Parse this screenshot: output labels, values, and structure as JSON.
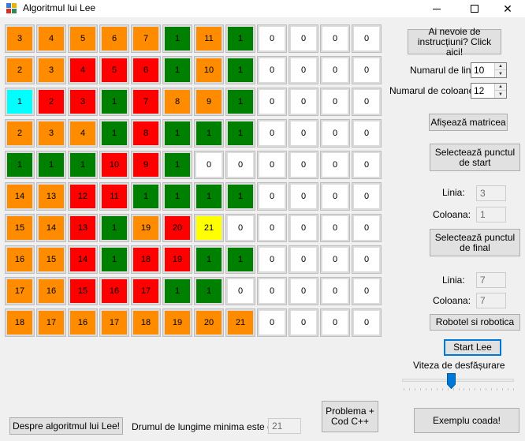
{
  "window": {
    "title": "Algoritmul lui Lee",
    "min_glyph": "—",
    "close_glyph": "✕"
  },
  "grid": [
    [
      {
        "v": "3",
        "c": "orange"
      },
      {
        "v": "4",
        "c": "orange"
      },
      {
        "v": "5",
        "c": "orange"
      },
      {
        "v": "6",
        "c": "orange"
      },
      {
        "v": "7",
        "c": "orange"
      },
      {
        "v": "1",
        "c": "green"
      },
      {
        "v": "11",
        "c": "orange"
      },
      {
        "v": "1",
        "c": "green"
      },
      {
        "v": "0",
        "c": "white"
      },
      {
        "v": "0",
        "c": "white"
      },
      {
        "v": "0",
        "c": "white"
      },
      {
        "v": "0",
        "c": "white"
      }
    ],
    [
      {
        "v": "2",
        "c": "orange"
      },
      {
        "v": "3",
        "c": "orange"
      },
      {
        "v": "4",
        "c": "red"
      },
      {
        "v": "5",
        "c": "red"
      },
      {
        "v": "6",
        "c": "red"
      },
      {
        "v": "1",
        "c": "green"
      },
      {
        "v": "10",
        "c": "orange"
      },
      {
        "v": "1",
        "c": "green"
      },
      {
        "v": "0",
        "c": "white"
      },
      {
        "v": "0",
        "c": "white"
      },
      {
        "v": "0",
        "c": "white"
      },
      {
        "v": "0",
        "c": "white"
      }
    ],
    [
      {
        "v": "1",
        "c": "cyan"
      },
      {
        "v": "2",
        "c": "red"
      },
      {
        "v": "3",
        "c": "red"
      },
      {
        "v": "1",
        "c": "green"
      },
      {
        "v": "7",
        "c": "red"
      },
      {
        "v": "8",
        "c": "orange"
      },
      {
        "v": "9",
        "c": "orange"
      },
      {
        "v": "1",
        "c": "green"
      },
      {
        "v": "0",
        "c": "white"
      },
      {
        "v": "0",
        "c": "white"
      },
      {
        "v": "0",
        "c": "white"
      },
      {
        "v": "0",
        "c": "white"
      }
    ],
    [
      {
        "v": "2",
        "c": "orange"
      },
      {
        "v": "3",
        "c": "orange"
      },
      {
        "v": "4",
        "c": "orange"
      },
      {
        "v": "1",
        "c": "green"
      },
      {
        "v": "8",
        "c": "red"
      },
      {
        "v": "1",
        "c": "green"
      },
      {
        "v": "1",
        "c": "green"
      },
      {
        "v": "1",
        "c": "green"
      },
      {
        "v": "0",
        "c": "white"
      },
      {
        "v": "0",
        "c": "white"
      },
      {
        "v": "0",
        "c": "white"
      },
      {
        "v": "0",
        "c": "white"
      }
    ],
    [
      {
        "v": "1",
        "c": "green"
      },
      {
        "v": "1",
        "c": "green"
      },
      {
        "v": "1",
        "c": "green"
      },
      {
        "v": "10",
        "c": "red"
      },
      {
        "v": "9",
        "c": "red"
      },
      {
        "v": "1",
        "c": "green"
      },
      {
        "v": "0",
        "c": "white"
      },
      {
        "v": "0",
        "c": "white"
      },
      {
        "v": "0",
        "c": "white"
      },
      {
        "v": "0",
        "c": "white"
      },
      {
        "v": "0",
        "c": "white"
      },
      {
        "v": "0",
        "c": "white"
      }
    ],
    [
      {
        "v": "14",
        "c": "orange"
      },
      {
        "v": "13",
        "c": "orange"
      },
      {
        "v": "12",
        "c": "red"
      },
      {
        "v": "11",
        "c": "red"
      },
      {
        "v": "1",
        "c": "green"
      },
      {
        "v": "1",
        "c": "green"
      },
      {
        "v": "1",
        "c": "green"
      },
      {
        "v": "1",
        "c": "green"
      },
      {
        "v": "0",
        "c": "white"
      },
      {
        "v": "0",
        "c": "white"
      },
      {
        "v": "0",
        "c": "white"
      },
      {
        "v": "0",
        "c": "white"
      }
    ],
    [
      {
        "v": "15",
        "c": "orange"
      },
      {
        "v": "14",
        "c": "orange"
      },
      {
        "v": "13",
        "c": "red"
      },
      {
        "v": "1",
        "c": "green"
      },
      {
        "v": "19",
        "c": "orange"
      },
      {
        "v": "20",
        "c": "red"
      },
      {
        "v": "21",
        "c": "yellow"
      },
      {
        "v": "0",
        "c": "white"
      },
      {
        "v": "0",
        "c": "white"
      },
      {
        "v": "0",
        "c": "white"
      },
      {
        "v": "0",
        "c": "white"
      },
      {
        "v": "0",
        "c": "white"
      }
    ],
    [
      {
        "v": "16",
        "c": "orange"
      },
      {
        "v": "15",
        "c": "orange"
      },
      {
        "v": "14",
        "c": "red"
      },
      {
        "v": "1",
        "c": "green"
      },
      {
        "v": "18",
        "c": "red"
      },
      {
        "v": "19",
        "c": "red"
      },
      {
        "v": "1",
        "c": "green"
      },
      {
        "v": "1",
        "c": "green"
      },
      {
        "v": "0",
        "c": "white"
      },
      {
        "v": "0",
        "c": "white"
      },
      {
        "v": "0",
        "c": "white"
      },
      {
        "v": "0",
        "c": "white"
      }
    ],
    [
      {
        "v": "17",
        "c": "orange"
      },
      {
        "v": "16",
        "c": "orange"
      },
      {
        "v": "15",
        "c": "red"
      },
      {
        "v": "16",
        "c": "red"
      },
      {
        "v": "17",
        "c": "red"
      },
      {
        "v": "1",
        "c": "green"
      },
      {
        "v": "1",
        "c": "green"
      },
      {
        "v": "0",
        "c": "white"
      },
      {
        "v": "0",
        "c": "white"
      },
      {
        "v": "0",
        "c": "white"
      },
      {
        "v": "0",
        "c": "white"
      },
      {
        "v": "0",
        "c": "white"
      }
    ],
    [
      {
        "v": "18",
        "c": "orange"
      },
      {
        "v": "17",
        "c": "orange"
      },
      {
        "v": "16",
        "c": "orange"
      },
      {
        "v": "17",
        "c": "orange"
      },
      {
        "v": "18",
        "c": "orange"
      },
      {
        "v": "19",
        "c": "orange"
      },
      {
        "v": "20",
        "c": "orange"
      },
      {
        "v": "21",
        "c": "orange"
      },
      {
        "v": "0",
        "c": "white"
      },
      {
        "v": "0",
        "c": "white"
      },
      {
        "v": "0",
        "c": "white"
      },
      {
        "v": "0",
        "c": "white"
      }
    ]
  ],
  "colors": {
    "orange": "#ff8c00",
    "red": "#ff0000",
    "green": "#008000",
    "cyan": "#00ffff",
    "yellow": "#ffff00",
    "white": "#ffffff",
    "accent": "#0078d7"
  },
  "right_panel": {
    "help_button": "Ai nevoie de instrucțiuni? Click aici!",
    "rows_label": "Numarul de lini:",
    "rows_value": "10",
    "cols_label": "Numarul de coloane:",
    "cols_value": "12",
    "show_matrix_button": "Afișează matricea",
    "select_start_button": "Selectează punctul de start",
    "start_row_label": "Linia:",
    "start_row_value": "3",
    "start_col_label": "Coloana:",
    "start_col_value": "1",
    "select_end_button": "Selectează punctul de final",
    "end_row_label": "Linia:",
    "end_row_value": "7",
    "end_col_label": "Coloana:",
    "end_col_value": "7",
    "robot_button": "Robotel si robotica",
    "start_lee_button": "Start Lee",
    "speed_label": "Viteza de desfășurare",
    "speed_value": 0.43,
    "speed_ticks": 21
  },
  "bottom": {
    "about_button": "Despre algoritmul lui Lee!",
    "path_label": "Drumul de lungime minima este de:",
    "path_value": "21",
    "problem_button": "Problema + Cod C++",
    "example_button": "Exemplu coada!"
  },
  "icons": [
    "app-icon",
    "minimize-icon",
    "maximize-icon",
    "close-icon",
    "spin-up-icon",
    "spin-down-icon",
    "slider-thumb-icon"
  ]
}
